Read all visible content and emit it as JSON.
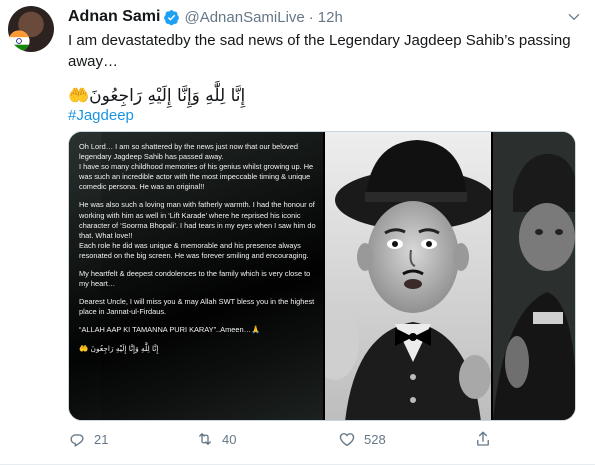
{
  "tweet": {
    "display_name": "Adnan Sami",
    "handle": "@AdnanSamiLive",
    "separator": "·",
    "time": "12h",
    "text": "I am devastatedby the sad news of the Legendary Jagdeep Sahib’s passing away…",
    "arabic": "إِنَّا لِلَّٰهِ وَإِنَّا إِلَيْهِ رَاجِعُونَ🤲",
    "hashtag": "#Jagdeep"
  },
  "media_note": {
    "p1": "Oh Lord… I am so shattered by the news just now that our beloved legendary Jagdeep Sahib has passed away.\nI have so many childhood memories of his genius whilst growing up. He was such an incredible actor with the most impeccable timing & unique comedic persona. He was an original!!",
    "p2": "He was also such a loving man with fatherly warmth. I had the honour of working with him as well in ‘Lift Karade’ where he reprised his iconic character of ‘Soorma Bhopali’. I had tears in my eyes when I saw him do that. What love!!\nEach role he did was unique & memorable and his presence always resonated on the big screen. He was forever smiling and encouraging.",
    "p3": "My heartfelt & deepest condolences to the family which is very close to my heart…",
    "p4": "Dearest Uncle, I will miss you & may Allah SWT bless you in the highest place in Jannat-ul-Firdaus.",
    "p5": "“ALLAH AAP KI TAMANNA PURI KARAY”..Ameen…🙏",
    "p6": "إِنَّا لِلَّٰهِ وَإِنَّا إِلَيْهِ رَاجِعُونَ 🤲"
  },
  "actions": {
    "reply_count": "21",
    "retweet_count": "40",
    "like_count": "528"
  },
  "colors": {
    "link": "#1b95e0",
    "muted": "#657786",
    "verified": "#1da1f2"
  },
  "icons": [
    "verified-icon",
    "chevron-down-icon",
    "reply-icon",
    "retweet-icon",
    "like-icon",
    "share-icon"
  ]
}
